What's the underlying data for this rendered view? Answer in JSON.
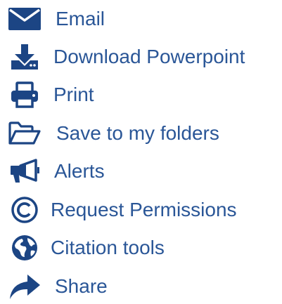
{
  "colors": {
    "icon": "#1c4584",
    "text": "#2a5697",
    "background": "#ffffff"
  },
  "tools": [
    {
      "id": "email",
      "icon": "envelope-icon",
      "label": "Email"
    },
    {
      "id": "download",
      "icon": "download-icon",
      "label": "Download Powerpoint"
    },
    {
      "id": "print",
      "icon": "printer-icon",
      "label": "Print"
    },
    {
      "id": "save",
      "icon": "folder-open-icon",
      "label": "Save to my folders"
    },
    {
      "id": "alerts",
      "icon": "megaphone-icon",
      "label": "Alerts"
    },
    {
      "id": "permissions",
      "icon": "copyright-icon",
      "label": "Request Permissions"
    },
    {
      "id": "citation",
      "icon": "globe-icon",
      "label": "Citation tools"
    },
    {
      "id": "share",
      "icon": "share-arrow-icon",
      "label": "Share"
    }
  ]
}
